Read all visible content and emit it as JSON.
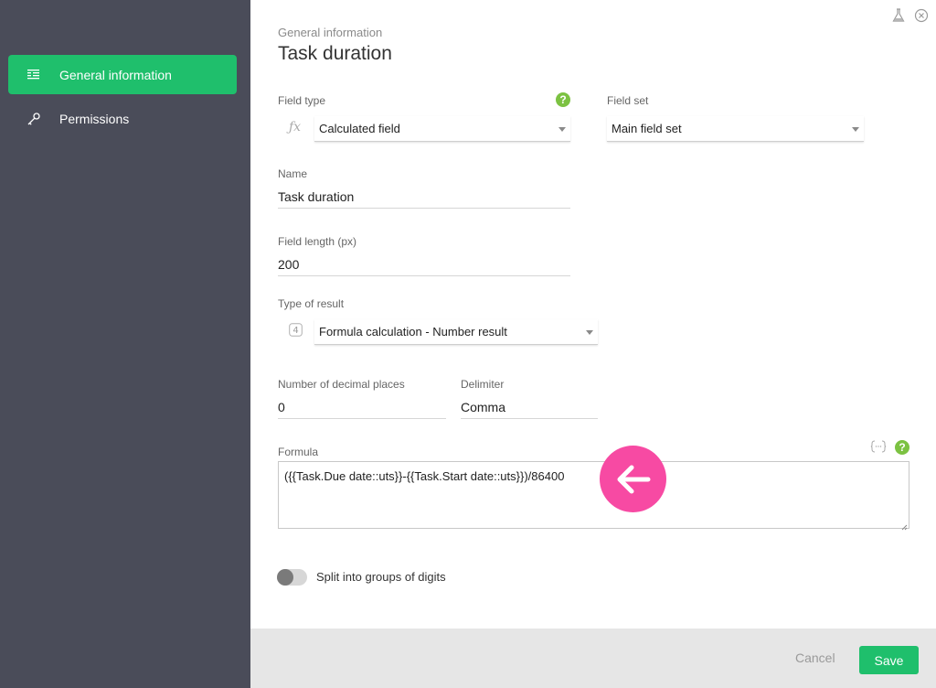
{
  "sidebar": {
    "items": [
      {
        "label": "General information",
        "icon": "list-icon",
        "active": true
      },
      {
        "label": "Permissions",
        "icon": "key-icon",
        "active": false
      }
    ]
  },
  "header": {
    "breadcrumb": "General information",
    "title": "Task duration",
    "icons": [
      "flask-icon",
      "close-icon"
    ]
  },
  "form": {
    "field_type": {
      "label": "Field type",
      "icon": "fx-icon",
      "value": "Calculated field"
    },
    "field_set": {
      "label": "Field set",
      "value": "Main field set"
    },
    "name": {
      "label": "Name",
      "value": "Task duration"
    },
    "field_length": {
      "label": "Field length (px)",
      "value": "200"
    },
    "type_of_result": {
      "label": "Type of result",
      "icon": "number-4-icon",
      "value": "Formula calculation - Number result"
    },
    "decimal_places": {
      "label": "Number of decimal places",
      "value": "0"
    },
    "delimiter": {
      "label": "Delimiter",
      "value": "Comma"
    },
    "formula": {
      "label": "Formula",
      "value": "({{Task.Due date::uts}}-{{Task.Start date::uts}})/86400"
    },
    "split_digits": {
      "label": "Split into groups of digits",
      "enabled": false
    }
  },
  "help_glyph": "?",
  "footer": {
    "cancel_label": "Cancel",
    "save_label": "Save"
  },
  "colors": {
    "accent": "#1fbf6c",
    "sidebar_bg": "#4a4c59",
    "help": "#7cc242",
    "highlight": "#f74aa3"
  }
}
